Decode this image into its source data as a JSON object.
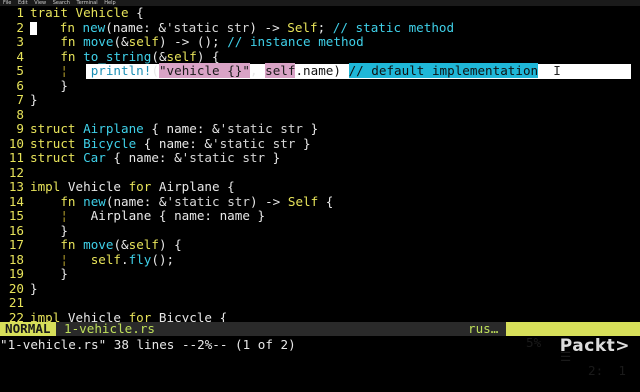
{
  "menubar": [
    "File",
    "Edit",
    "View",
    "Search",
    "Terminal",
    "Help"
  ],
  "lines": [
    {
      "n": "1"
    },
    {
      "n": "2"
    },
    {
      "n": "3"
    },
    {
      "n": "4"
    },
    {
      "n": "5"
    },
    {
      "n": "6"
    },
    {
      "n": "7"
    },
    {
      "n": "8"
    },
    {
      "n": "9"
    },
    {
      "n": "10"
    },
    {
      "n": "11"
    },
    {
      "n": "12"
    },
    {
      "n": "13"
    },
    {
      "n": "14"
    },
    {
      "n": "15"
    },
    {
      "n": "16"
    },
    {
      "n": "17"
    },
    {
      "n": "18"
    },
    {
      "n": "19"
    },
    {
      "n": "20"
    },
    {
      "n": "21"
    },
    {
      "n": "22"
    }
  ],
  "status": {
    "mode": "NORMAL",
    "filename": "1-vehicle.rs",
    "filetype": "rus…",
    "percent": "5%",
    "bars": "☰",
    "linecol": "2:  1"
  },
  "cmdline": "\"1-vehicle.rs\" 38 lines --2%-- (1 of 2)",
  "logo": "Packt>"
}
